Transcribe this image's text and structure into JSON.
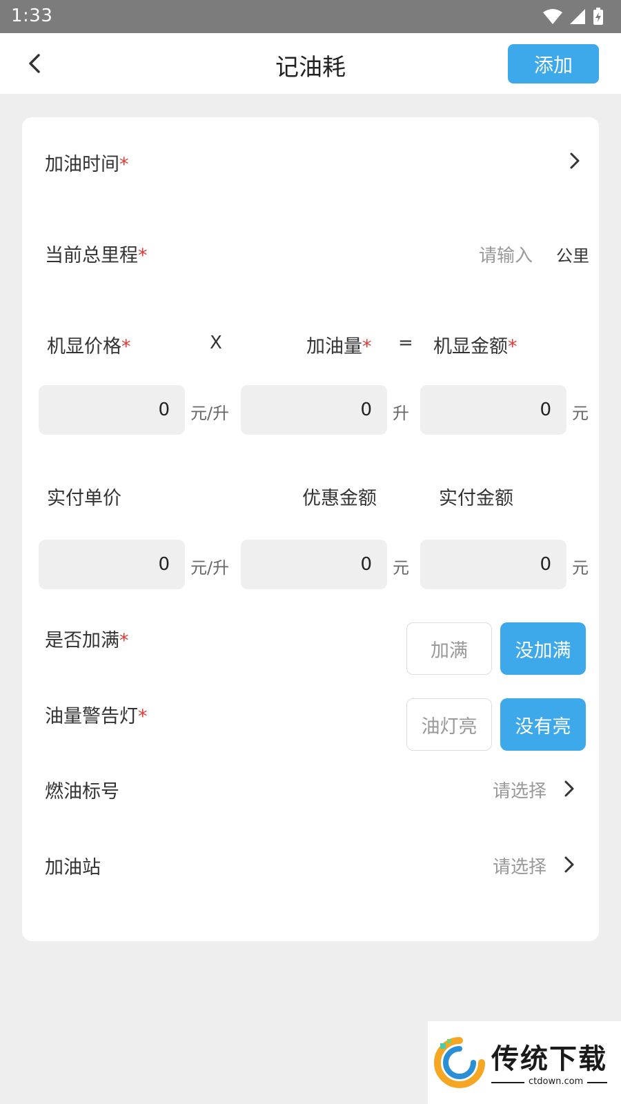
{
  "status_bar": {
    "time": "1:33"
  },
  "nav": {
    "title": "记油耗",
    "add_label": "添加"
  },
  "form": {
    "refuel_time": {
      "label": "加油时间",
      "required": "*"
    },
    "odometer": {
      "label": "当前总里程",
      "required": "*",
      "placeholder": "请输入",
      "unit": "公里"
    },
    "calc_labels": {
      "price": "机显价格",
      "qty": "加油量",
      "amount": "机显金额",
      "required": "*",
      "times": "X",
      "equals": "="
    },
    "calc_values": {
      "price": "0",
      "price_unit": "元/升",
      "qty": "0",
      "qty_unit": "升",
      "amount": "0",
      "amount_unit": "元"
    },
    "paid_labels": {
      "unit_price": "实付单价",
      "discount": "优惠金额",
      "paid_amount": "实付金额"
    },
    "paid_values": {
      "unit_price": "0",
      "unit_price_unit": "元/升",
      "discount": "0",
      "discount_unit": "元",
      "paid_amount": "0",
      "paid_amount_unit": "元"
    },
    "full_tank": {
      "label": "是否加满",
      "required": "*",
      "option_full": "加满",
      "option_not_full": "没加满",
      "selected": "没加满"
    },
    "warning_light": {
      "label": "油量警告灯",
      "required": "*",
      "option_on": "油灯亮",
      "option_off": "没有亮",
      "selected": "没有亮"
    },
    "fuel_grade": {
      "label": "燃油标号",
      "placeholder": "请选择"
    },
    "gas_station": {
      "label": "加油站",
      "placeholder": "请选择"
    }
  },
  "watermark": {
    "brand": "传统下载",
    "url": "ctdown.com"
  },
  "colors": {
    "accent": "#3da9ea",
    "required": "#e53935",
    "page_bg": "#eeeeee",
    "status_bar": "#7c7c7c"
  }
}
